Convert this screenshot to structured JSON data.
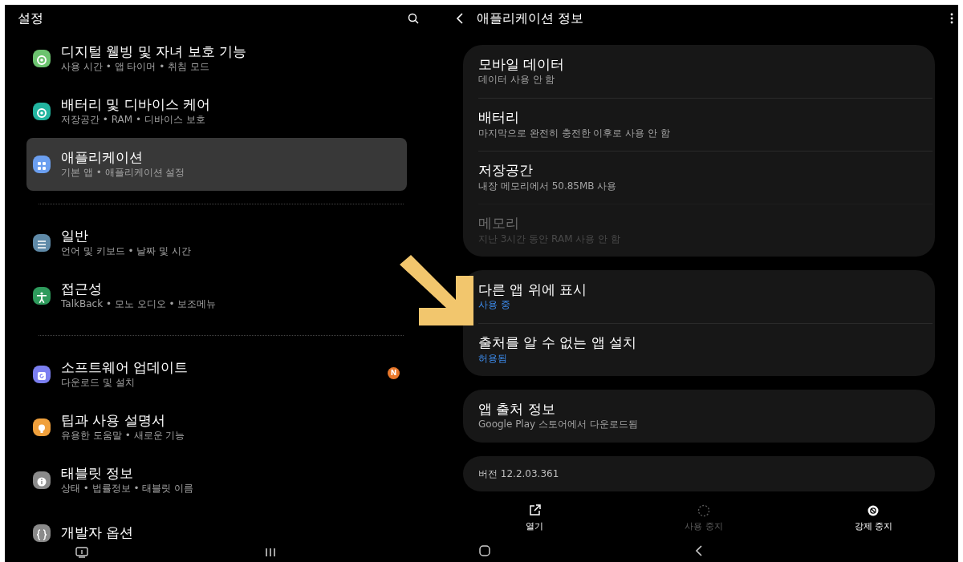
{
  "settings_panel": {
    "title": "설정",
    "sections": [
      {
        "items": [
          {
            "kind": "ring",
            "color": "#6cc36f",
            "title": "디지털 웰빙 및 자녀 보호 기능",
            "subtitle": "사용 시간 • 앱 타이머 • 취침 모드",
            "selected": false
          },
          {
            "kind": "ring",
            "color": "#22b5a0",
            "title": "배터리 및 디바이스 케어",
            "subtitle": "저장공간 • RAM • 디바이스 보호",
            "selected": false
          },
          {
            "kind": "grid",
            "color": "#6b9ff0",
            "title": "애플리케이션",
            "subtitle": "기본 앱 • 애플리케이션 설정",
            "selected": true
          }
        ]
      },
      {
        "items": [
          {
            "kind": "sliders",
            "color": "#5f8aa8",
            "title": "일반",
            "subtitle": "언어 및 키보드 • 날짜 및 시간",
            "selected": false
          },
          {
            "kind": "person",
            "color": "#2e9a5c",
            "title": "접근성",
            "subtitle": "TalkBack • 모노 오디오 • 보조메뉴",
            "selected": false
          }
        ]
      },
      {
        "items": [
          {
            "kind": "update",
            "color": "#7b7ff0",
            "title": "소프트웨어 업데이트",
            "subtitle": "다운로드 및 설치",
            "selected": false,
            "badge": "N"
          },
          {
            "kind": "bulb",
            "color": "#f0a03c",
            "title": "팁과 사용 설명서",
            "subtitle": "유용한 도움말 • 새로운 기능",
            "selected": false
          },
          {
            "kind": "info",
            "color": "#8a8a8a",
            "title": "태블릿 정보",
            "subtitle": "상태 • 법률정보 • 태블릿 이름",
            "selected": false
          },
          {
            "kind": "braces",
            "color": "#8a8a8a",
            "title": "개발자 옵션",
            "selected": false
          }
        ]
      }
    ]
  },
  "app_info": {
    "title": "애플리케이션 정보",
    "cards": [
      {
        "rows": [
          {
            "kind": "summary",
            "title": "모바일 데이터",
            "subtitle": "데이터 사용 안 함",
            "disabled": false
          },
          {
            "kind": "summary",
            "title": "배터리",
            "subtitle": "마지막으로 완전히 충전한 이후로 사용 안 함",
            "disabled": false
          },
          {
            "kind": "summary",
            "title": "저장공간",
            "subtitle": "내장 메모리에서 50.85MB 사용",
            "disabled": false
          },
          {
            "kind": "summary",
            "title": "메모리",
            "subtitle": "지난 3시간 동안 RAM 사용 안 함",
            "disabled": true
          }
        ]
      },
      {
        "rows": [
          {
            "kind": "value",
            "title": "다른 앱 위에 표시",
            "subtitle": "사용 중",
            "disabled": false
          },
          {
            "kind": "value",
            "title": "출처를 알 수 없는 앱 설치",
            "subtitle": "허용됨",
            "disabled": false
          }
        ]
      },
      {
        "rows": [
          {
            "kind": "summary",
            "title": "앱 출처 정보",
            "subtitle": "Google Play 스토어에서 다운로드됨",
            "disabled": false
          }
        ]
      },
      {
        "rows": [
          {
            "kind": "caption",
            "title": "버전 12.2.03.361",
            "disabled": false
          }
        ]
      }
    ],
    "actions": [
      {
        "kind": "open",
        "label": "열기",
        "disabled": false
      },
      {
        "kind": "dashed",
        "label": "사용 중지",
        "disabled": true
      },
      {
        "kind": "stop",
        "label": "강제 중지",
        "disabled": false
      }
    ]
  }
}
